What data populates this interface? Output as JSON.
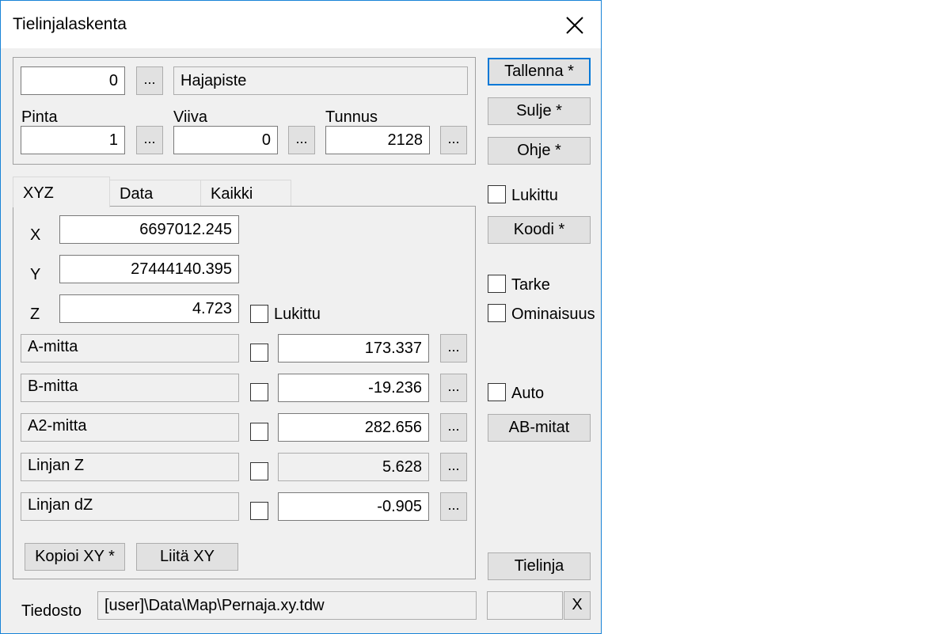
{
  "window": {
    "title": "Tielinjalaskenta"
  },
  "top_group": {
    "hajapiste_value": "0",
    "hajapiste_label": "Hajapiste",
    "pinta_label": "Pinta",
    "pinta_value": "1",
    "viiva_label": "Viiva",
    "viiva_value": "0",
    "tunnus_label": "Tunnus",
    "tunnus_value": "2128",
    "browse_label": "..."
  },
  "tabs": [
    {
      "label": "XYZ",
      "active": true
    },
    {
      "label": "Data",
      "active": false
    },
    {
      "label": "Kaikki",
      "active": false
    }
  ],
  "xyz": {
    "x_label": "X",
    "x_value": "6697012.245",
    "y_label": "Y",
    "y_value": "27444140.395",
    "z_label": "Z",
    "z_value": "4.723",
    "z_lock_label": "Lukittu"
  },
  "measures": [
    {
      "label": "A-mitta",
      "value": "173.337"
    },
    {
      "label": "B-mitta",
      "value": "-19.236"
    },
    {
      "label": "A2-mitta",
      "value": "282.656"
    },
    {
      "label": "Linjan Z",
      "value": "5.628"
    },
    {
      "label": "Linjan dZ",
      "value": "-0.905"
    }
  ],
  "bottom_buttons": {
    "copy_label": "Kopioi XY *",
    "paste_label": "Liitä XY"
  },
  "side_panel": {
    "save_label": "Tallenna *",
    "close_label": "Sulje *",
    "help_label": "Ohje *",
    "locked_label": "Lukittu",
    "code_label": "Koodi *",
    "tarke_label": "Tarke",
    "ominaisuus_label": "Ominaisuus",
    "auto_label": "Auto",
    "ab_label": "AB-mitat",
    "tielinja_label": "Tielinja"
  },
  "file": {
    "label": "Tiedosto",
    "path": "[user]\\Data\\Map\\Pernaja.xy.tdw",
    "clear_label": "X"
  }
}
